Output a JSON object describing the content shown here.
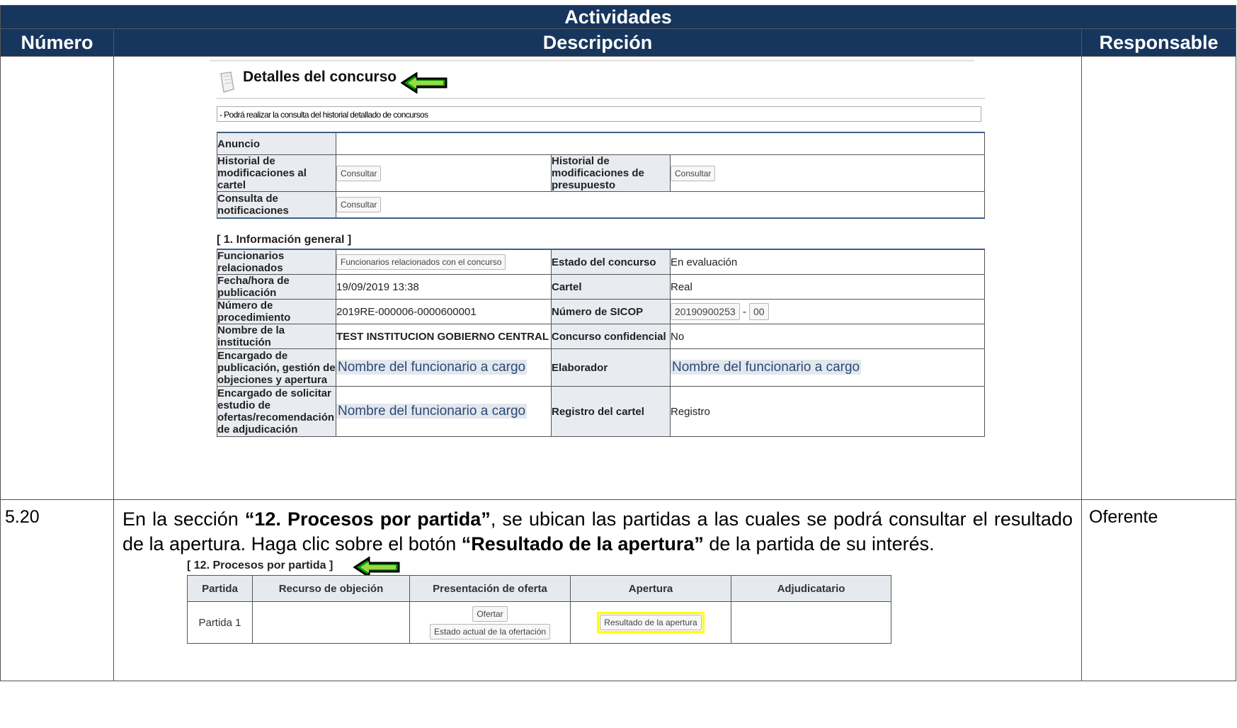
{
  "header": {
    "title": "Actividades",
    "col_number": "Número",
    "col_description": "Descripción",
    "col_responsible": "Responsable"
  },
  "shot1": {
    "title": "Detalles del concurso",
    "note": "- Podrá realizar la consulta del historial detallado de concursos",
    "anuncio": "Anuncio",
    "hist_cartel": "Historial de modificaciones al cartel",
    "hist_presupuesto": "Historial de modificaciones de presupuesto",
    "notificaciones": "Consulta de notificaciones",
    "consultar": "Consultar",
    "section1": "[ 1. Información general ]",
    "rows": {
      "funcionarios_label": "Funcionarios relacionados",
      "funcionarios_btn": "Funcionarios relacionados con el concurso",
      "estado_label": "Estado del concurso",
      "estado_value": "En evaluación",
      "fecha_label": "Fecha/hora de publicación",
      "fecha_value": "19/09/2019 13:38",
      "cartel_label": "Cartel",
      "cartel_value": "Real",
      "numproc_label": "Número de procedimiento",
      "numproc_value": "2019RE-000006-0000600001",
      "sicop_label": "Número de SICOP",
      "sicop_value": "20190900253",
      "sicop_suffix": "00",
      "inst_label": "Nombre de la institución",
      "inst_value": "TEST INSTITUCION GOBIERNO CENTRAL",
      "confid_label": "Concurso confidencial",
      "confid_value": "No",
      "encargado_pub_label": "Encargado de publicación, gestión de objeciones y apertura",
      "funcionario_placeholder": "Nombre del funcionario a cargo",
      "elaborador_label": "Elaborador",
      "encargado_sol_label": "Encargado de solicitar estudio de ofertas/recomendación de adjudicación",
      "registro_label": "Registro del cartel",
      "registro_value": "Registro"
    }
  },
  "row520": {
    "number": "5.20",
    "p1": "En la sección ",
    "b1": "“12. Procesos por partida”",
    "p2": ", se ubican las partidas a las cuales se podrá consultar el resultado de la apertura. Haga clic sobre el botón ",
    "b2": "“Resultado de la apertura”",
    "p3": " de la partida de su interés.",
    "responsible": "Oferente"
  },
  "shot2": {
    "title": "[ 12. Procesos por partida ]",
    "headers": [
      "Partida",
      "Recurso de objeción",
      "Presentación de oferta",
      "Apertura",
      "Adjudicatario"
    ],
    "partida": "Partida 1",
    "ofertar": "Ofertar",
    "estado_ofertacion": "Estado actual de la ofertación",
    "resultado": "Resultado de la apertura"
  }
}
